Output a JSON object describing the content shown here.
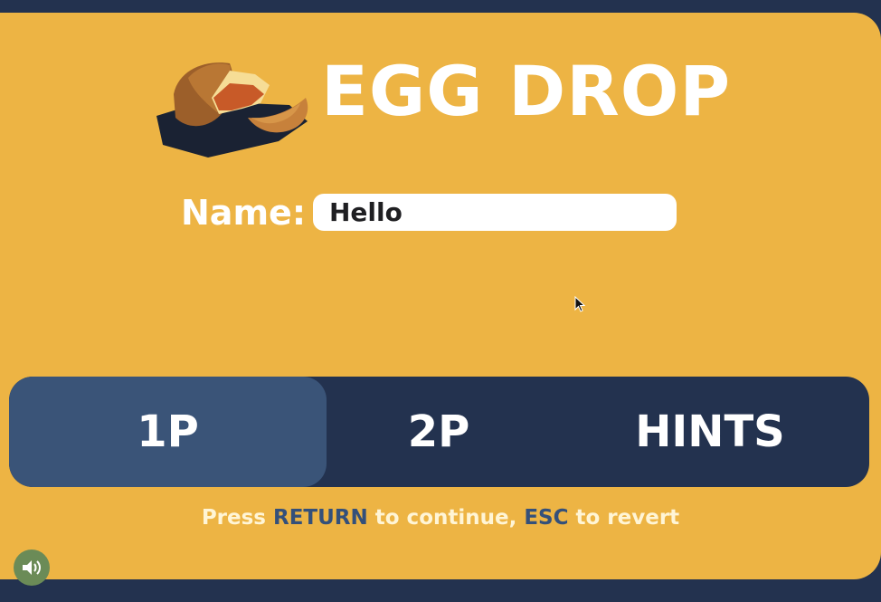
{
  "game": {
    "title": "EGG DROP",
    "name_label": "Name:",
    "name_value": "Hello"
  },
  "menu": {
    "items": [
      "1P",
      "2P",
      "HINTS"
    ],
    "selected": "1P"
  },
  "hint": {
    "prefix": "Press ",
    "key1": "RETURN",
    "middle": " to continue, ",
    "key2": "ESC",
    "suffix": " to revert"
  },
  "icons": {
    "logo": "cracked-egg-icon",
    "sound": "speaker-icon",
    "pointer": "mouse-cursor-icon"
  },
  "colors": {
    "background": "#23324f",
    "panel": "#edb444",
    "menu_bar": "#23324f",
    "menu_selected": "#3a5478",
    "key_highlight": "#34507a",
    "sound_button": "#6b8b57"
  }
}
